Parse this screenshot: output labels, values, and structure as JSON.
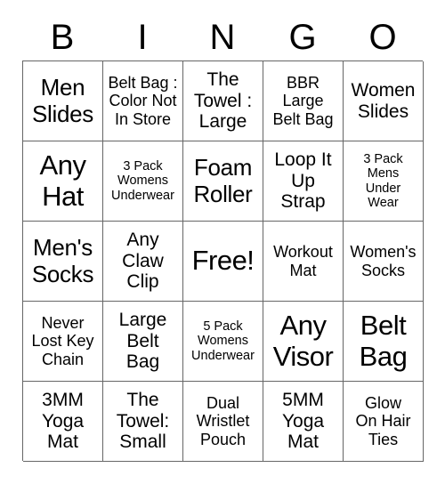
{
  "card": {
    "title": "BINGO",
    "header_letters": [
      "B",
      "I",
      "N",
      "G",
      "O"
    ],
    "grid_size": "5x5",
    "free_space_label": "Free!",
    "colors": {
      "background": "#ffffff",
      "text": "#000000",
      "grid_line": "#666666"
    },
    "rows": [
      [
        {
          "text": "Men\nSlides",
          "size": "lg"
        },
        {
          "text": "Belt Bag :\nColor Not\nIn Store",
          "size": "sm"
        },
        {
          "text": "The\nTowel :\nLarge",
          "size": "md"
        },
        {
          "text": "BBR\nLarge\nBelt Bag",
          "size": "sm"
        },
        {
          "text": "Women\nSlides",
          "size": "md"
        }
      ],
      [
        {
          "text": "Any\nHat",
          "size": "xl"
        },
        {
          "text": "3 Pack\nWomens\nUnderwear",
          "size": "xs"
        },
        {
          "text": "Foam\nRoller",
          "size": "lg"
        },
        {
          "text": "Loop It\nUp\nStrap",
          "size": "md"
        },
        {
          "text": "3 Pack\nMens\nUnder\nWear",
          "size": "xs"
        }
      ],
      [
        {
          "text": "Men's\nSocks",
          "size": "lg"
        },
        {
          "text": "Any\nClaw\nClip",
          "size": "md"
        },
        {
          "text": "Free!",
          "size": "xl"
        },
        {
          "text": "Workout\nMat",
          "size": "sm"
        },
        {
          "text": "Women's\nSocks",
          "size": "sm"
        }
      ],
      [
        {
          "text": "Never\nLost Key\nChain",
          "size": "sm"
        },
        {
          "text": "Large\nBelt\nBag",
          "size": "md"
        },
        {
          "text": "5 Pack\nWomens\nUnderwear",
          "size": "xs"
        },
        {
          "text": "Any\nVisor",
          "size": "xl"
        },
        {
          "text": "Belt\nBag",
          "size": "xl"
        }
      ],
      [
        {
          "text": "3MM\nYoga\nMat",
          "size": "md"
        },
        {
          "text": "The\nTowel:\nSmall",
          "size": "md"
        },
        {
          "text": "Dual\nWristlet\nPouch",
          "size": "sm"
        },
        {
          "text": "5MM\nYoga\nMat",
          "size": "md"
        },
        {
          "text": "Glow\nOn Hair\nTies",
          "size": "sm"
        }
      ]
    ]
  }
}
